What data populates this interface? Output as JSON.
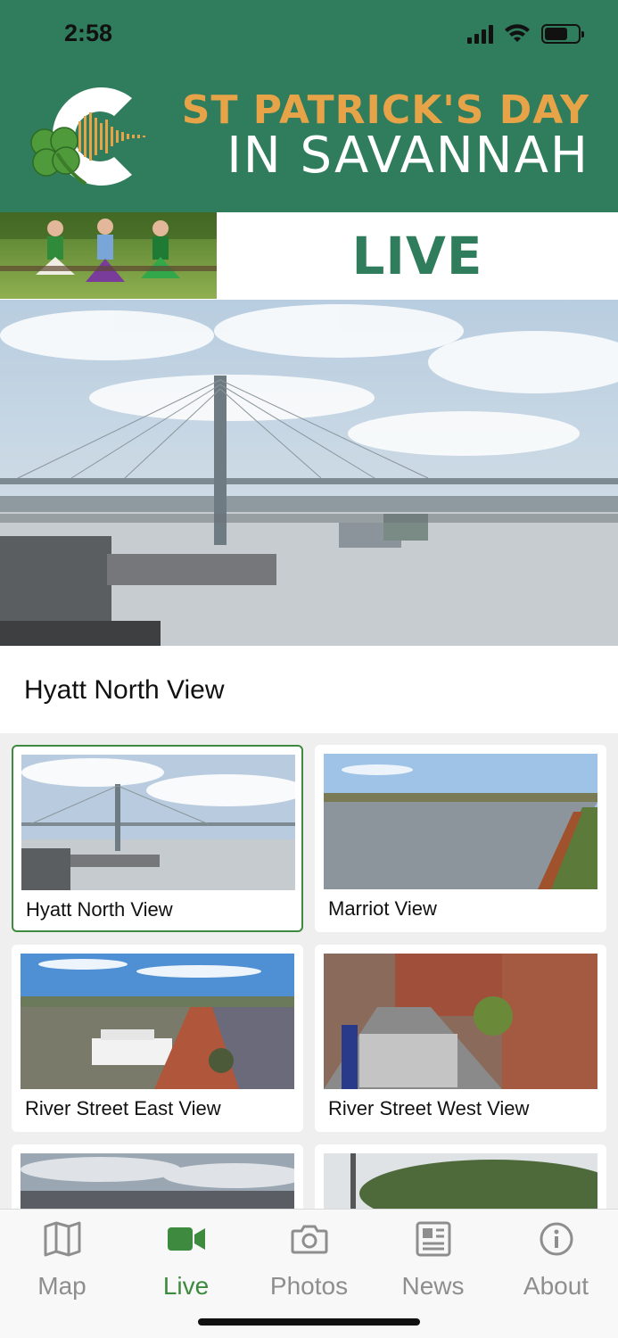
{
  "status_bar": {
    "time": "2:58"
  },
  "header": {
    "title_line1": "ST PATRICK'S DAY",
    "title_line2": "IN SAVANNAH",
    "colors": {
      "background": "#2f7d5d",
      "accent": "#e7a347",
      "text": "#ffffff"
    }
  },
  "banner": {
    "label": "LIVE"
  },
  "main_cam": {
    "caption": "Hyatt North View"
  },
  "cameras": [
    {
      "label": "Hyatt North View",
      "selected": true
    },
    {
      "label": "Marriot View",
      "selected": false
    },
    {
      "label": "River Street East View",
      "selected": false
    },
    {
      "label": "River Street West View",
      "selected": false
    }
  ],
  "tabs": [
    {
      "label": "Map",
      "icon": "map-icon",
      "active": false
    },
    {
      "label": "Live",
      "icon": "video-camera-icon",
      "active": true
    },
    {
      "label": "Photos",
      "icon": "camera-icon",
      "active": false
    },
    {
      "label": "News",
      "icon": "newspaper-icon",
      "active": false
    },
    {
      "label": "About",
      "icon": "info-icon",
      "active": false
    }
  ]
}
